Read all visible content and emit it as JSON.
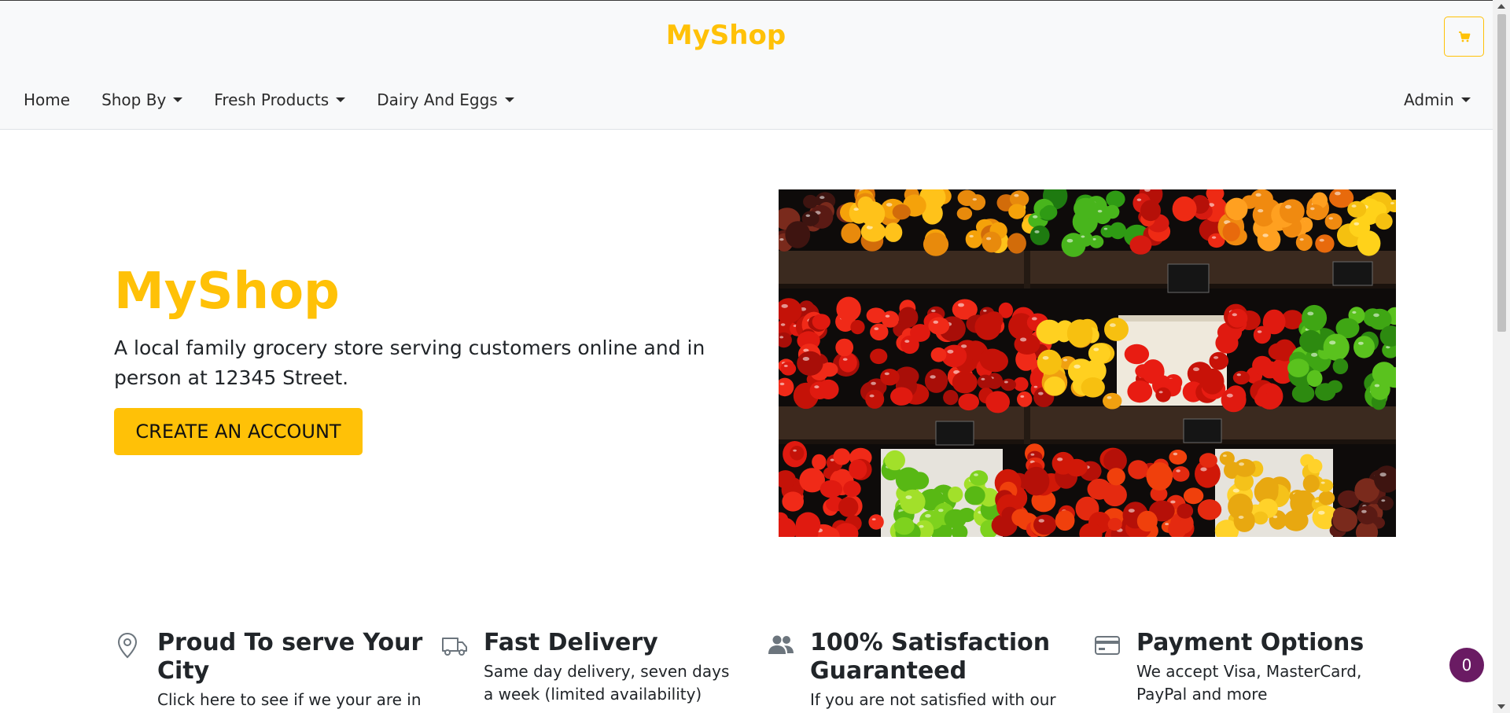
{
  "navbar": {
    "brand": "MyShop",
    "links": [
      {
        "label": "Home",
        "dropdown": false
      },
      {
        "label": "Shop By",
        "dropdown": true
      },
      {
        "label": "Fresh Products",
        "dropdown": true
      },
      {
        "label": "Dairy And Eggs",
        "dropdown": true
      }
    ],
    "admin_label": "Admin",
    "cart_icon": "cart-icon"
  },
  "hero": {
    "title": "MyShop",
    "text": "A local family grocery store serving customers online and in person at 12345 Street.",
    "cta_label": "CREATE AN ACCOUNT",
    "image_alt": "Produce shelves with tomatoes and peppers"
  },
  "features": [
    {
      "icon": "map-pin-icon",
      "title": "Proud To serve Your City",
      "text": "Click here to see if we your are in"
    },
    {
      "icon": "truck-icon",
      "title": "Fast Delivery",
      "text": "Same day delivery, seven days a week (limited availability)"
    },
    {
      "icon": "users-icon",
      "title": "100% Satisfaction Guaranteed",
      "text": "If you are not satisfied with our"
    },
    {
      "icon": "credit-card-icon",
      "title": "Payment Options",
      "text": "We accept Visa, MasterCard, PayPal and more"
    }
  ],
  "chat_badge": {
    "count": "0"
  },
  "colors": {
    "accent": "#ffc107",
    "badge": "#6a1b63",
    "navbar_bg": "#f8f9fa"
  }
}
